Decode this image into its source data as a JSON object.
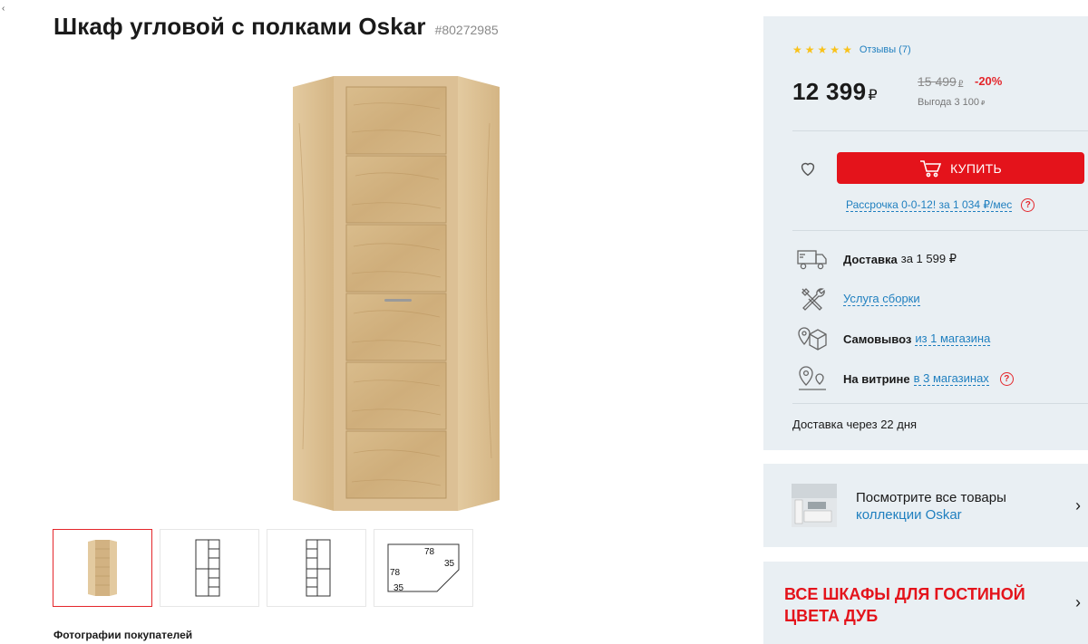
{
  "corner_mark": "‹",
  "product": {
    "title": "Шкаф угловой с полками Oskar",
    "sku": "#80272985"
  },
  "thumbnails": [
    {
      "kind": "photo",
      "active": true
    },
    {
      "kind": "scheme-left",
      "active": false
    },
    {
      "kind": "scheme-right",
      "active": false
    },
    {
      "kind": "dimensions",
      "active": false,
      "labels": [
        "78",
        "35",
        "78",
        "35"
      ]
    }
  ],
  "buyer_photos_label": "Фотографии покупателей",
  "panel": {
    "rating_stars": 5,
    "reviews_label": "Отзывы (7)",
    "price": "12 399",
    "currency": "₽",
    "old_price": "15 499",
    "discount": "-20%",
    "savings": "Выгода 3 100",
    "buy_label": "КУПИТЬ",
    "installment": "Рассрочка 0-0-12! за 1 034 ₽/мес",
    "services": [
      {
        "icon": "truck-icon",
        "bold": "Доставка",
        "plain": "за 1 599 ₽",
        "link": "",
        "help": false
      },
      {
        "icon": "tools-icon",
        "bold": "",
        "plain": "",
        "link": "Услуга сборки",
        "help": false
      },
      {
        "icon": "pickup-box-icon",
        "bold": "Самовывоз",
        "plain": "",
        "link": "из 1 магазина",
        "help": false
      },
      {
        "icon": "map-pin-icon",
        "bold": "На витрине",
        "plain": "",
        "link": "в 3 магазинах",
        "help": true
      }
    ],
    "delivery_time": "Доставка через 22 дня"
  },
  "collection": {
    "line1": "Посмотрите все товары",
    "line2": "коллекции Oskar"
  },
  "all_wardrobes": "ВСЕ ШКАФЫ ДЛЯ ГОСТИНОЙ ЦВЕТА ДУБ",
  "colors": {
    "accent_red": "#e4131b",
    "link_blue": "#1f7fbf",
    "panel_bg": "#e9eff3",
    "star": "#f9c21a"
  }
}
